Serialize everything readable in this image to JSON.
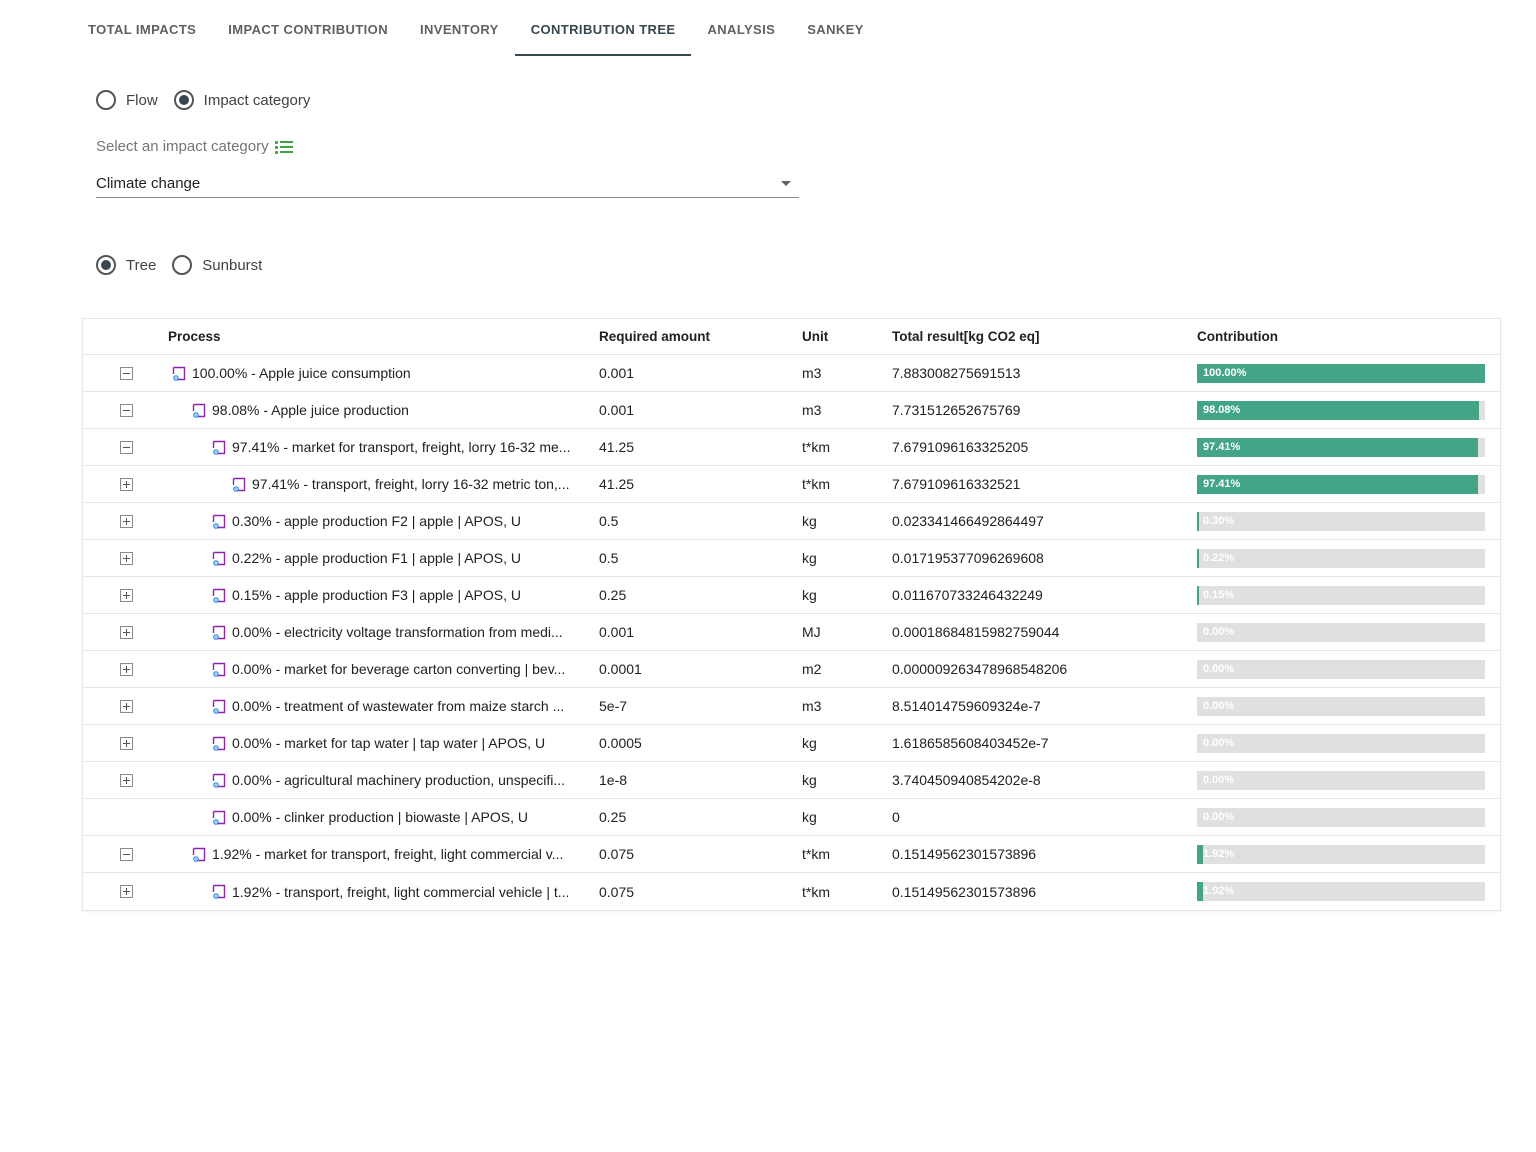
{
  "tabs": [
    {
      "label": "TOTAL IMPACTS",
      "active": false
    },
    {
      "label": "IMPACT CONTRIBUTION",
      "active": false
    },
    {
      "label": "INVENTORY",
      "active": false
    },
    {
      "label": "CONTRIBUTION TREE",
      "active": true
    },
    {
      "label": "ANALYSIS",
      "active": false
    },
    {
      "label": "SANKEY",
      "active": false
    }
  ],
  "mode_options": {
    "flow": "Flow",
    "impact_category": "Impact category",
    "selected": "impact_category"
  },
  "impact_select": {
    "label": "Select an impact category",
    "value": "Climate change"
  },
  "view_options": {
    "tree": "Tree",
    "sunburst": "Sunburst",
    "selected": "tree"
  },
  "table": {
    "headers": {
      "process": "Process",
      "amount": "Required amount",
      "unit": "Unit",
      "total": "Total result[kg CO2 eq]",
      "contribution": "Contribution"
    },
    "rows": [
      {
        "expander": "minus",
        "level": 0,
        "process": "100.00% - Apple juice consumption",
        "amount": "0.001",
        "unit": "m3",
        "total": "7.883008275691513",
        "contribution": 100.0,
        "label": "100.00%"
      },
      {
        "expander": "minus",
        "level": 1,
        "process": "98.08% - Apple juice production",
        "amount": "0.001",
        "unit": "m3",
        "total": "7.731512652675769",
        "contribution": 98.08,
        "label": "98.08%"
      },
      {
        "expander": "minus",
        "level": 2,
        "process": "97.41% - market for transport, freight, lorry 16-32 me...",
        "amount": "41.25",
        "unit": "t*km",
        "total": "7.6791096163325205",
        "contribution": 97.41,
        "label": "97.41%"
      },
      {
        "expander": "plus",
        "level": 3,
        "process": "97.41% - transport, freight, lorry 16-32 metric ton,...",
        "amount": "41.25",
        "unit": "t*km",
        "total": "7.679109616332521",
        "contribution": 97.41,
        "label": "97.41%"
      },
      {
        "expander": "plus",
        "level": 2,
        "process": "0.30% - apple production F2 | apple | APOS, U",
        "amount": "0.5",
        "unit": "kg",
        "total": "0.023341466492864497",
        "contribution": 0.3,
        "label": "0.30%"
      },
      {
        "expander": "plus",
        "level": 2,
        "process": "0.22% - apple production F1 | apple | APOS, U",
        "amount": "0.5",
        "unit": "kg",
        "total": "0.017195377096269608",
        "contribution": 0.22,
        "label": "0.22%"
      },
      {
        "expander": "plus",
        "level": 2,
        "process": "0.15% - apple production F3 | apple | APOS, U",
        "amount": "0.25",
        "unit": "kg",
        "total": "0.011670733246432249",
        "contribution": 0.15,
        "label": "0.15%"
      },
      {
        "expander": "plus",
        "level": 2,
        "process": "0.00% - electricity voltage transformation from medi...",
        "amount": "0.001",
        "unit": "MJ",
        "total": "0.00018684815982759044",
        "contribution": 0.0,
        "label": "0.00%"
      },
      {
        "expander": "plus",
        "level": 2,
        "process": "0.00% - market for beverage carton converting | bev...",
        "amount": "0.0001",
        "unit": "m2",
        "total": "0.000009263478968548206",
        "contribution": 0.0,
        "label": "0.00%"
      },
      {
        "expander": "plus",
        "level": 2,
        "process": "0.00% - treatment of wastewater from maize starch ...",
        "amount": "5e-7",
        "unit": "m3",
        "total": "8.514014759609324e-7",
        "contribution": 0.0,
        "label": "0.00%"
      },
      {
        "expander": "plus",
        "level": 2,
        "process": "0.00% - market for tap water | tap water | APOS, U",
        "amount": "0.0005",
        "unit": "kg",
        "total": "1.6186585608403452e-7",
        "contribution": 0.0,
        "label": "0.00%"
      },
      {
        "expander": "plus",
        "level": 2,
        "process": "0.00% - agricultural machinery production, unspecifi...",
        "amount": "1e-8",
        "unit": "kg",
        "total": "3.740450940854202e-8",
        "contribution": 0.0,
        "label": "0.00%"
      },
      {
        "expander": "none",
        "level": 2,
        "process": "0.00% - clinker production | biowaste | APOS, U",
        "amount": "0.25",
        "unit": "kg",
        "total": "0",
        "contribution": 0.0,
        "label": "0.00%"
      },
      {
        "expander": "minus",
        "level": 1,
        "process": "1.92% - market for transport, freight, light commercial v...",
        "amount": "0.075",
        "unit": "t*km",
        "total": "0.15149562301573896",
        "contribution": 1.92,
        "label": "1.92%"
      },
      {
        "expander": "plus",
        "level": 2,
        "process": "1.92% - transport, freight, light commercial vehicle | t...",
        "amount": "0.075",
        "unit": "t*km",
        "total": "0.15149562301573896",
        "contribution": 1.92,
        "label": "1.92%"
      }
    ]
  },
  "colors": {
    "bar_fill": "#43a587",
    "bar_bg": "#e0e0e0",
    "accent": "#37474f",
    "list_icon": "#43a047",
    "process_icon": "#8e24aa"
  }
}
